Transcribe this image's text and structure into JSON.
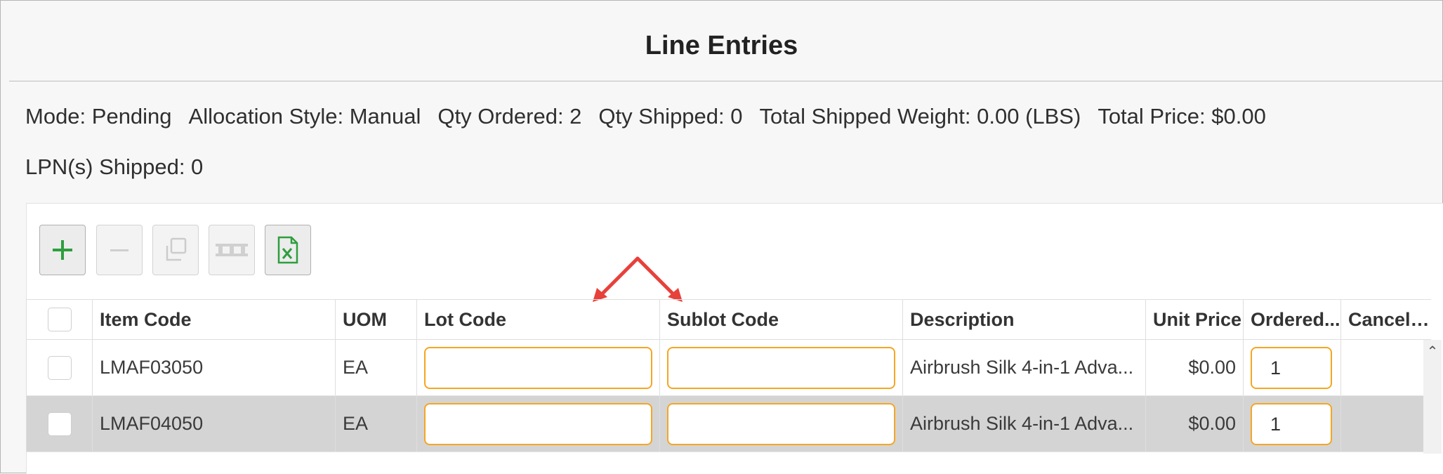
{
  "title": "Line Entries",
  "summary": {
    "mode": "Mode: Pending",
    "allocation_style": "Allocation Style: Manual",
    "qty_ordered": "Qty Ordered: 2",
    "qty_shipped": "Qty Shipped: 0",
    "total_shipped_weight": "Total Shipped Weight: 0.00 (LBS)",
    "total_price": "Total Price: $0.00",
    "lpn_shipped": "LPN(s) Shipped: 0"
  },
  "toolbar": {
    "add_icon": "plus-icon",
    "remove_icon": "minus-icon",
    "copy_icon": "copy-icon",
    "pallet_icon": "pallet-icon",
    "excel_icon": "excel-icon",
    "accent": "#2e9e3e"
  },
  "grid": {
    "columns": [
      "Item Code",
      "UOM",
      "Lot Code",
      "Sublot Code",
      "Description",
      "Unit Price",
      "Ordered...",
      "Cancel ..."
    ],
    "rows": [
      {
        "item_code": "LMAF03050",
        "uom": "EA",
        "lot_code": "",
        "sublot_code": "",
        "description": "Airbrush Silk 4-in-1 Adva...",
        "unit_price": "$0.00",
        "ordered": "1",
        "cancel": ""
      },
      {
        "item_code": "LMAF04050",
        "uom": "EA",
        "lot_code": "",
        "sublot_code": "",
        "description": "Airbrush Silk 4-in-1 Adva...",
        "unit_price": "$0.00",
        "ordered": "1",
        "cancel": ""
      }
    ]
  },
  "colors": {
    "edit_border": "#f5a623",
    "annotation_arrow": "#e8403a",
    "selected_row": "#d4d4d4"
  }
}
